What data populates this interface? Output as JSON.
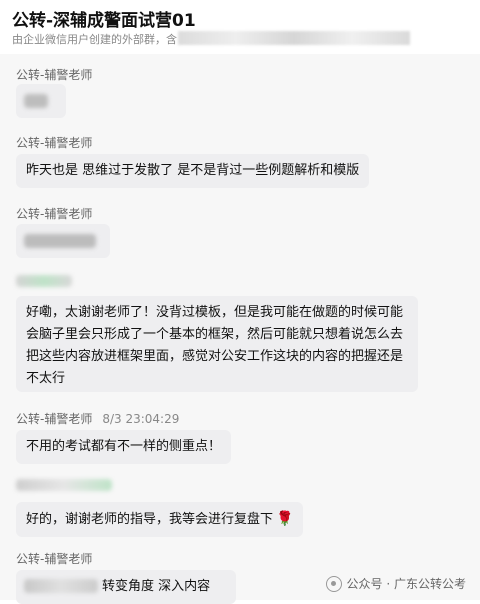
{
  "header": {
    "title": "公转-深辅成警面试营01",
    "subtitle": "由企业微信用户创建的外部群，含"
  },
  "messages": [
    {
      "sender": "公转-辅警老师",
      "time": "",
      "text": ""
    },
    {
      "sender": "公转-辅警老师",
      "time": "",
      "text": "昨天也是 思维过于发散了 是不是背过一些例题解析和模版"
    },
    {
      "sender": "公转-辅警老师",
      "time": "",
      "text": ""
    },
    {
      "sender": "",
      "time": "",
      "text": "好嘞，太谢谢老师了！没背过模板，但是我可能在做题的时候可能会脑子里会只形成了一个基本的框架，然后可能就只想着说怎么去把这些内容放进框架里面，感觉对公安工作这块的内容的把握还是不太行"
    },
    {
      "sender": "公转-辅警老师",
      "time": "8/3 23:04:29",
      "text": "不用的考试都有不一样的侧重点！"
    },
    {
      "sender": "",
      "time": "",
      "text": "好的，谢谢老师的指导，我等会进行复盘下"
    },
    {
      "sender": "公转-辅警老师",
      "time": "",
      "text": "转变角度 深入内容"
    }
  ],
  "watermark": {
    "text": "公众号 · 广东公转公考",
    "icon": "wechat-official-account-icon"
  },
  "emoji": {
    "rose": "🌹"
  }
}
